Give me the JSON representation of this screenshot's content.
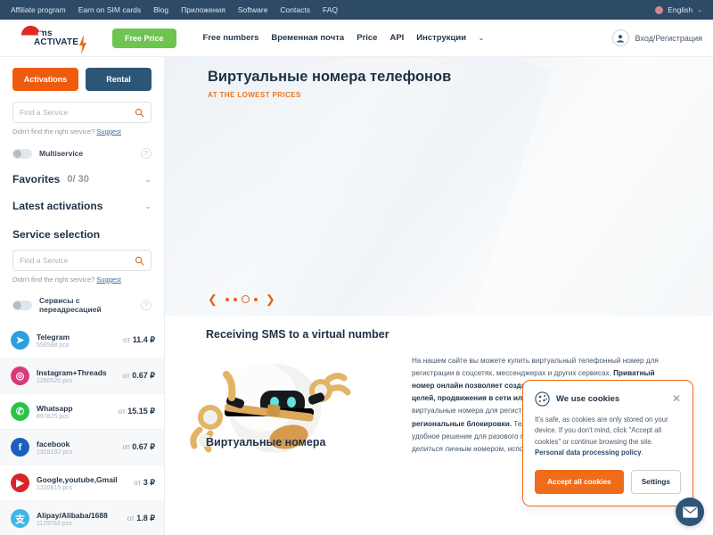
{
  "topbar": {
    "links": [
      "Affiliate program",
      "Earn on SIM cards",
      "Blog",
      "Приложения",
      "Software",
      "Contacts",
      "FAQ"
    ],
    "language": "English",
    "chevron": "⌄"
  },
  "header": {
    "logo_line1": "sms",
    "logo_line2": "ACTIVATE",
    "free_price": "Free Price",
    "nav": [
      "Free numbers",
      "Временная почта",
      "Price",
      "API",
      "Инструкции"
    ],
    "nav_chevron": "⌄",
    "login": "Вход/Регистрация"
  },
  "sidebar": {
    "tabs": [
      {
        "label": "Activations",
        "active": true
      },
      {
        "label": "Rental",
        "active": false
      }
    ],
    "search_top": {
      "placeholder": "Find a Service",
      "value": ""
    },
    "hint_text": "Didn't find the right service?",
    "hint_link": "Suggest",
    "multiservice_label": "Multiservice",
    "multiservice_help": "?",
    "favorites_label": "Favorites",
    "favorites_count": "0/ 30",
    "latest_label": "Latest activations",
    "service_selection_label": "Service selection",
    "search_bottom": {
      "placeholder": "Find a Service",
      "value": ""
    },
    "forwarding_label": "Сервисы с переадресацией",
    "forwarding_help": "?",
    "chevron": "⌄",
    "price_prefix": "от",
    "services": [
      {
        "name": "Telegram",
        "count": "558588 pcs",
        "price": "11.4 ₽",
        "color": "#2ba0dd",
        "glyph": "➤"
      },
      {
        "name": "Instagram+Threads",
        "count": "1260520 pcs",
        "price": "0.67 ₽",
        "color": "#d73b79",
        "glyph": "◎"
      },
      {
        "name": "Whatsapp",
        "count": "897825 pcs",
        "price": "15.15 ₽",
        "color": "#29c24a",
        "glyph": "✆"
      },
      {
        "name": "facebook",
        "count": "1318192 pcs",
        "price": "0.67 ₽",
        "color": "#1a5fbd",
        "glyph": "f"
      },
      {
        "name": "Google,youtube,Gmail",
        "count": "1220815 pcs",
        "price": "3 ₽",
        "color": "#d7252a",
        "glyph": "▶"
      },
      {
        "name": "Alipay/Alibaba/1688",
        "count": "1129763 pcs",
        "price": "1.8 ₽",
        "color": "#3fb5e8",
        "glyph": "支"
      }
    ]
  },
  "hero": {
    "title": "Виртуальные номера телефонов",
    "subtitle": "AT THE LOWEST PRICES",
    "prev": "❮",
    "next": "❯",
    "dots_total": 4,
    "dot_active_index": 2
  },
  "content": {
    "heading": "Receiving SMS to a virtual number",
    "paragraph_parts": [
      {
        "text": "На нашем сайте вы можете купить виртуальный телефонный номер для регистрации в соцсетях, мессенджерах и других сервисах. ",
        "bold": false
      },
      {
        "text": "Приватный номер онлайн позволяет создавать аккаунты для коммерческих целей, продвижения в сети или анонимного общения. ",
        "bold": true
      },
      {
        "text": "Мы предлагаем виртуальные номера для регистрации, которые помогают ",
        "bold": false
      },
      {
        "text": "обходить региональные блокировки. ",
        "bold": true
      },
      {
        "text": "Телефонный номер без SIM-карты — это удобное решение для разового получения кода. Если вы не хотите делиться личным номером, используйте номера SMS-Activate!",
        "bold": false
      }
    ],
    "bottom_heading": "Виртуальные номера"
  },
  "cookie": {
    "title": "We use cookies",
    "close": "✕",
    "body_prefix": "It's safe, as cookies are only stored on your device. If you don't mind, click \"Accept all cookies\" or continue browsing the site. ",
    "body_link": "Personal data processing policy",
    "body_suffix": ".",
    "accept_label": "Accept all cookies",
    "settings_label": "Settings"
  },
  "colors": {
    "accent_orange": "#ef6c1a",
    "dark_blue": "#2d5575",
    "green": "#6dc44f",
    "topbar_bg": "#2d4a66"
  }
}
